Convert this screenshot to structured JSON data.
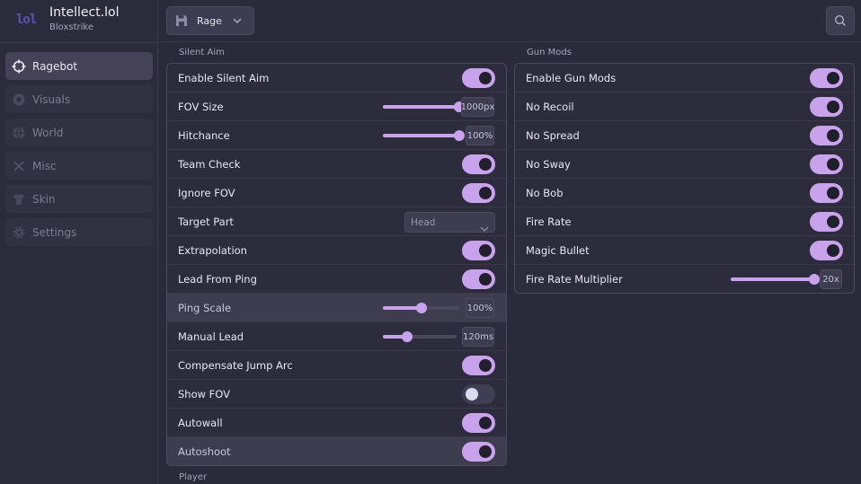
{
  "brand": {
    "logo": "lol",
    "title": "Intellect.lol",
    "subtitle": "Bloxstrike"
  },
  "sidebar": {
    "items": [
      {
        "label": "Ragebot",
        "icon": "crosshair-icon",
        "active": true
      },
      {
        "label": "Visuals",
        "icon": "eye-icon",
        "active": false
      },
      {
        "label": "World",
        "icon": "globe-icon",
        "active": false
      },
      {
        "label": "Misc",
        "icon": "close-icon",
        "active": false
      },
      {
        "label": "Skin",
        "icon": "shirt-icon",
        "active": false
      },
      {
        "label": "Settings",
        "icon": "gear-icon",
        "active": false
      }
    ]
  },
  "topbar": {
    "config_label": "Rage",
    "config_icon": "save-icon",
    "search_icon": "search-icon"
  },
  "silent_aim": {
    "title": "Silent Aim",
    "rows": [
      {
        "label": "Enable Silent Aim",
        "type": "toggle",
        "on": true
      },
      {
        "label": "FOV Size",
        "type": "slider",
        "value_text": "1000px",
        "fraction": 1.0
      },
      {
        "label": "Hitchance",
        "type": "slider",
        "value_text": "100%",
        "fraction": 1.0
      },
      {
        "label": "Team Check",
        "type": "toggle",
        "on": true
      },
      {
        "label": "Ignore FOV",
        "type": "toggle",
        "on": true
      },
      {
        "label": "Target Part",
        "type": "dropdown",
        "value_text": "Head"
      },
      {
        "label": "Extrapolation",
        "type": "toggle",
        "on": true
      },
      {
        "label": "Lead From Ping",
        "type": "toggle",
        "on": true
      },
      {
        "label": "Ping Scale",
        "type": "slider",
        "value_text": "100%",
        "fraction": 0.5
      },
      {
        "label": "Manual Lead",
        "type": "slider",
        "value_text": "120ms",
        "fraction": 0.33
      },
      {
        "label": "Compensate Jump Arc",
        "type": "toggle",
        "on": true
      },
      {
        "label": "Show FOV",
        "type": "toggle",
        "on": false
      },
      {
        "label": "Autowall",
        "type": "toggle",
        "on": true
      },
      {
        "label": "Autoshoot",
        "type": "toggle",
        "on": true
      }
    ]
  },
  "gun_mods": {
    "title": "Gun Mods",
    "rows": [
      {
        "label": "Enable Gun Mods",
        "type": "toggle",
        "on": true
      },
      {
        "label": "No Recoil",
        "type": "toggle",
        "on": true
      },
      {
        "label": "No Spread",
        "type": "toggle",
        "on": true
      },
      {
        "label": "No Sway",
        "type": "toggle",
        "on": true
      },
      {
        "label": "No Bob",
        "type": "toggle",
        "on": true
      },
      {
        "label": "Fire Rate",
        "type": "toggle",
        "on": true
      },
      {
        "label": "Magic Bullet",
        "type": "toggle",
        "on": true
      },
      {
        "label": "Fire Rate Multiplier",
        "type": "slider",
        "value_text": "20x",
        "fraction": 1.0
      }
    ]
  },
  "player": {
    "title": "Player"
  },
  "colors": {
    "accent": "#c9a2ec",
    "panel": "#2d2c3d",
    "background": "#2b2a3b"
  }
}
